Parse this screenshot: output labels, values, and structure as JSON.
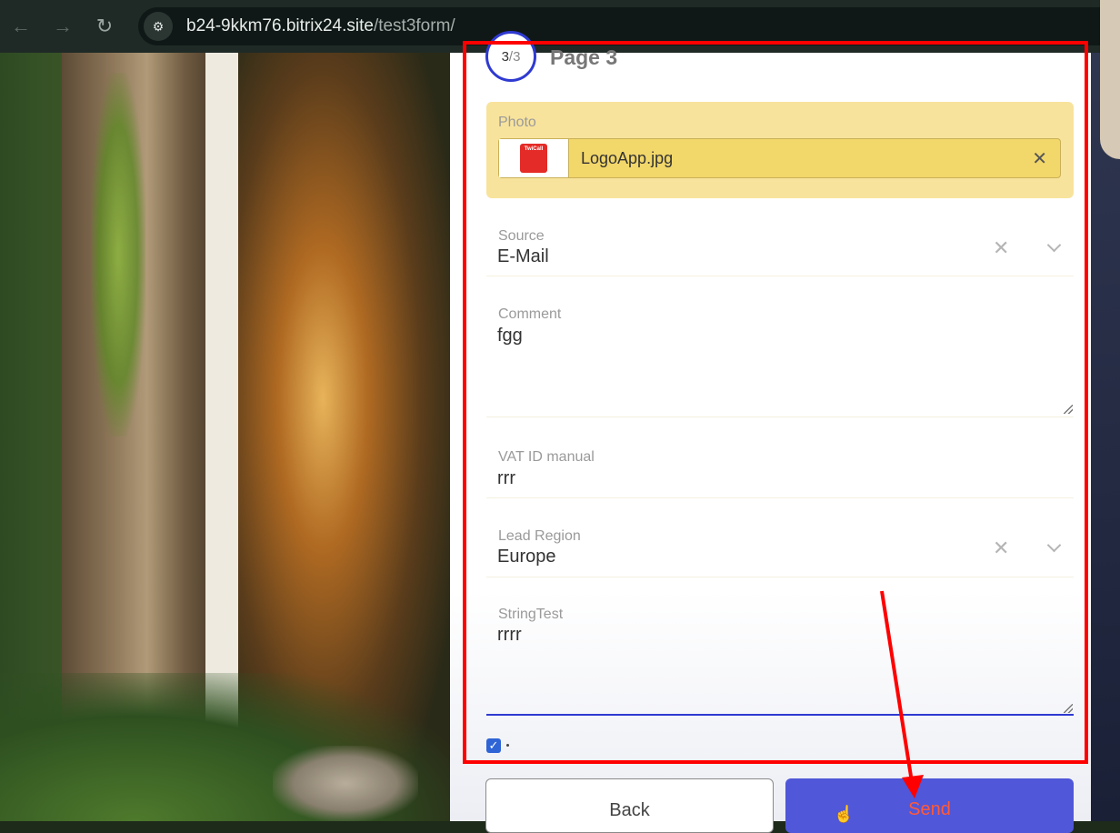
{
  "browser": {
    "back_icon": "arrow-left",
    "forward_icon": "arrow-right",
    "reload_icon": "reload",
    "site_info_icon": "tune",
    "url_host": "b24-9kkm76.bitrix24.site",
    "url_path": "/test3form/"
  },
  "form": {
    "step": {
      "current": "3",
      "total": "/3"
    },
    "page_title": "Page 3",
    "photo": {
      "label": "Photo",
      "file_name": "LogoApp.jpg",
      "thumb_text": "TwiCall",
      "clear": "✕"
    },
    "source": {
      "label": "Source",
      "value": "E-Mail",
      "clear": "✕"
    },
    "comment": {
      "label": "Comment",
      "value": "fgg"
    },
    "vat": {
      "label": "VAT ID manual",
      "value": "rrr"
    },
    "lead_region": {
      "label": "Lead Region",
      "value": "Europe",
      "clear": "✕"
    },
    "string_test": {
      "label": "StringTest",
      "value": "rrrr"
    },
    "agreement": {
      "checked": true,
      "check": "✓"
    },
    "buttons": {
      "back": "Back",
      "send": "Send"
    }
  },
  "colors": {
    "accent": "#2f3ad1",
    "send_button": "#5057d8",
    "photo_highlight": "#f8e39c",
    "annotation": "#ff0000"
  }
}
